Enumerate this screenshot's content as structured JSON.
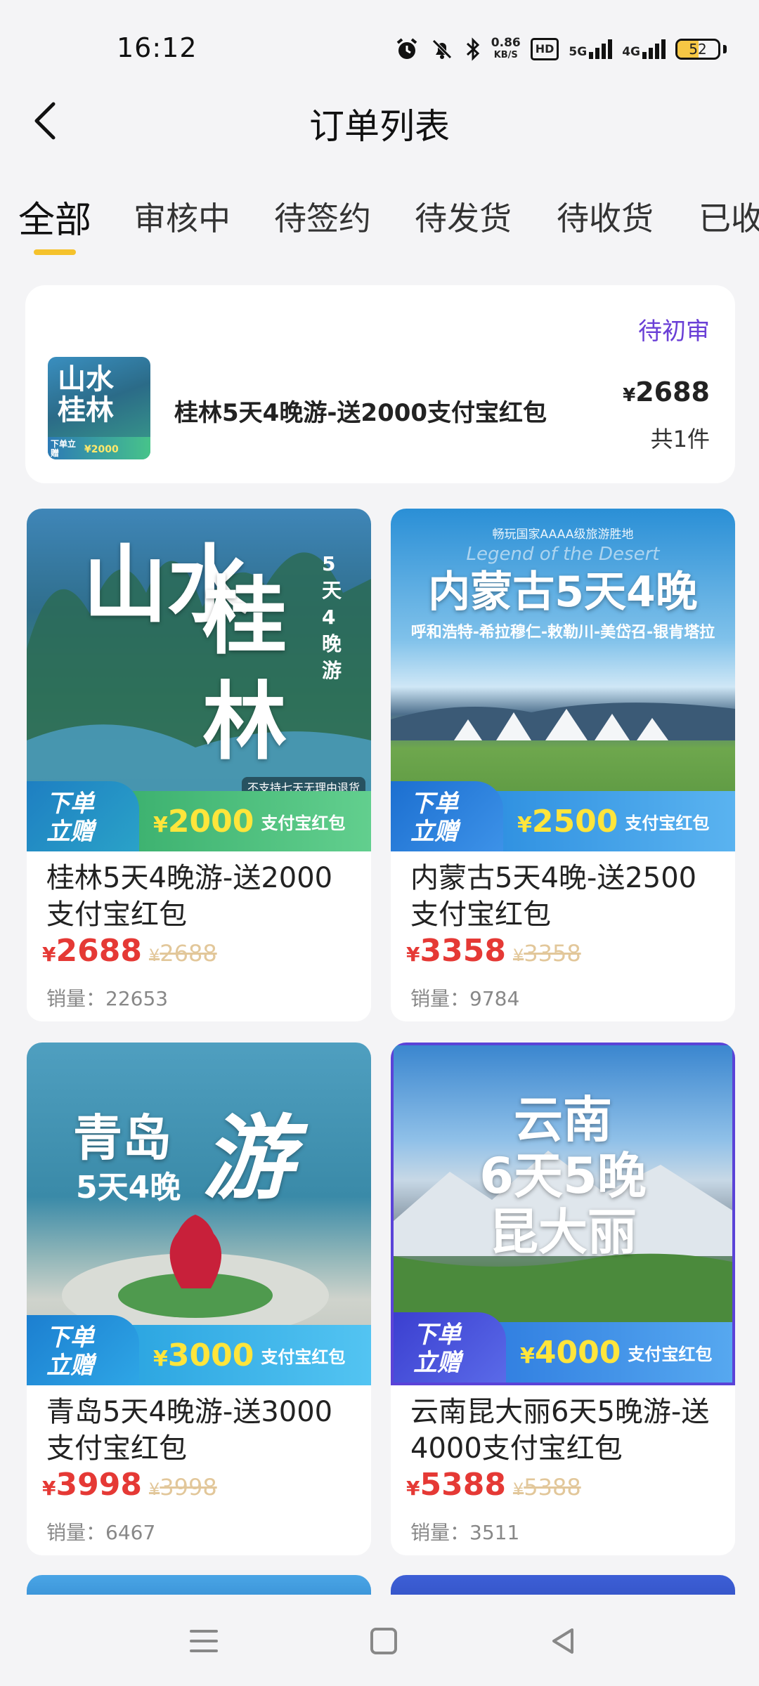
{
  "status_bar": {
    "time": "16:12",
    "net_speed_value": "0.86",
    "net_speed_unit": "KB/S",
    "hd_label": "HD",
    "sig1_label": "5G",
    "sig2_label": "4G",
    "battery": "52",
    "battery_level": 0.52,
    "icons": [
      "alarm-icon",
      "mute-bell-icon",
      "bluetooth-icon"
    ]
  },
  "header": {
    "title": "订单列表"
  },
  "tabs": [
    {
      "label": "全部"
    },
    {
      "label": "审核中"
    },
    {
      "label": "待签约"
    },
    {
      "label": "待发货"
    },
    {
      "label": "待收货"
    },
    {
      "label": "已收"
    }
  ],
  "order": {
    "status": "待初审",
    "thumb_title": "山水桂林",
    "thumb_gift": "下单立赠",
    "thumb_amount": "¥2000",
    "name": "桂林5天4晚游-送2000支付宝红包",
    "price_symbol": "¥",
    "price": "2688",
    "count": "共1件"
  },
  "products": [
    {
      "img_title_a": "山水",
      "img_title_b": "桂林",
      "img_side": "5天4晚游",
      "img_note": "不支持七天无理由退货",
      "gift": "下单立赠",
      "promo_amount": "2000",
      "promo_text": "支付宝红包",
      "name": "桂林5天4晚游-送2000支付宝红包",
      "price": "2688",
      "old_price": "2688",
      "sales": "销量：22653"
    },
    {
      "img_top": "畅玩国家AAAA级旅游胜地",
      "img_title_a": "内蒙古5天4晚",
      "img_script": "Legend of the Desert",
      "img_sub": "呼和浩特-希拉穆仁-敕勒川-美岱召-银肯塔拉",
      "gift": "下单立赠",
      "promo_amount": "2500",
      "promo_text": "支付宝红包",
      "name": "内蒙古5天4晚-送2500支付宝红包",
      "price": "3358",
      "old_price": "3358",
      "sales": "销量：9784"
    },
    {
      "img_title_a": "青岛",
      "img_title_b": "游",
      "img_sub": "5天4晚",
      "gift": "下单立赠",
      "promo_amount": "3000",
      "promo_text": "支付宝红包",
      "name": "青岛5天4晚游-送3000支付宝红包",
      "price": "3998",
      "old_price": "3998",
      "sales": "销量：6467"
    },
    {
      "img_title_a": "云南",
      "img_title_b": "6天5晚",
      "img_sub": "昆大丽",
      "gift": "下单立赠",
      "promo_amount": "4000",
      "promo_text": "支付宝红包",
      "name": "云南昆大丽6天5晚游-送4000支付宝红包",
      "price": "5388",
      "old_price": "5388",
      "sales": "销量：3511"
    }
  ],
  "currency": "¥",
  "colors": {
    "accent_tab": "#f5c22c",
    "status_purple": "#6a3fd6",
    "price_red": "#e53935",
    "promo_yellow": "#ffe53b"
  },
  "nav": {
    "icons": [
      "menu-icon",
      "home-square-icon",
      "back-triangle-icon"
    ]
  }
}
